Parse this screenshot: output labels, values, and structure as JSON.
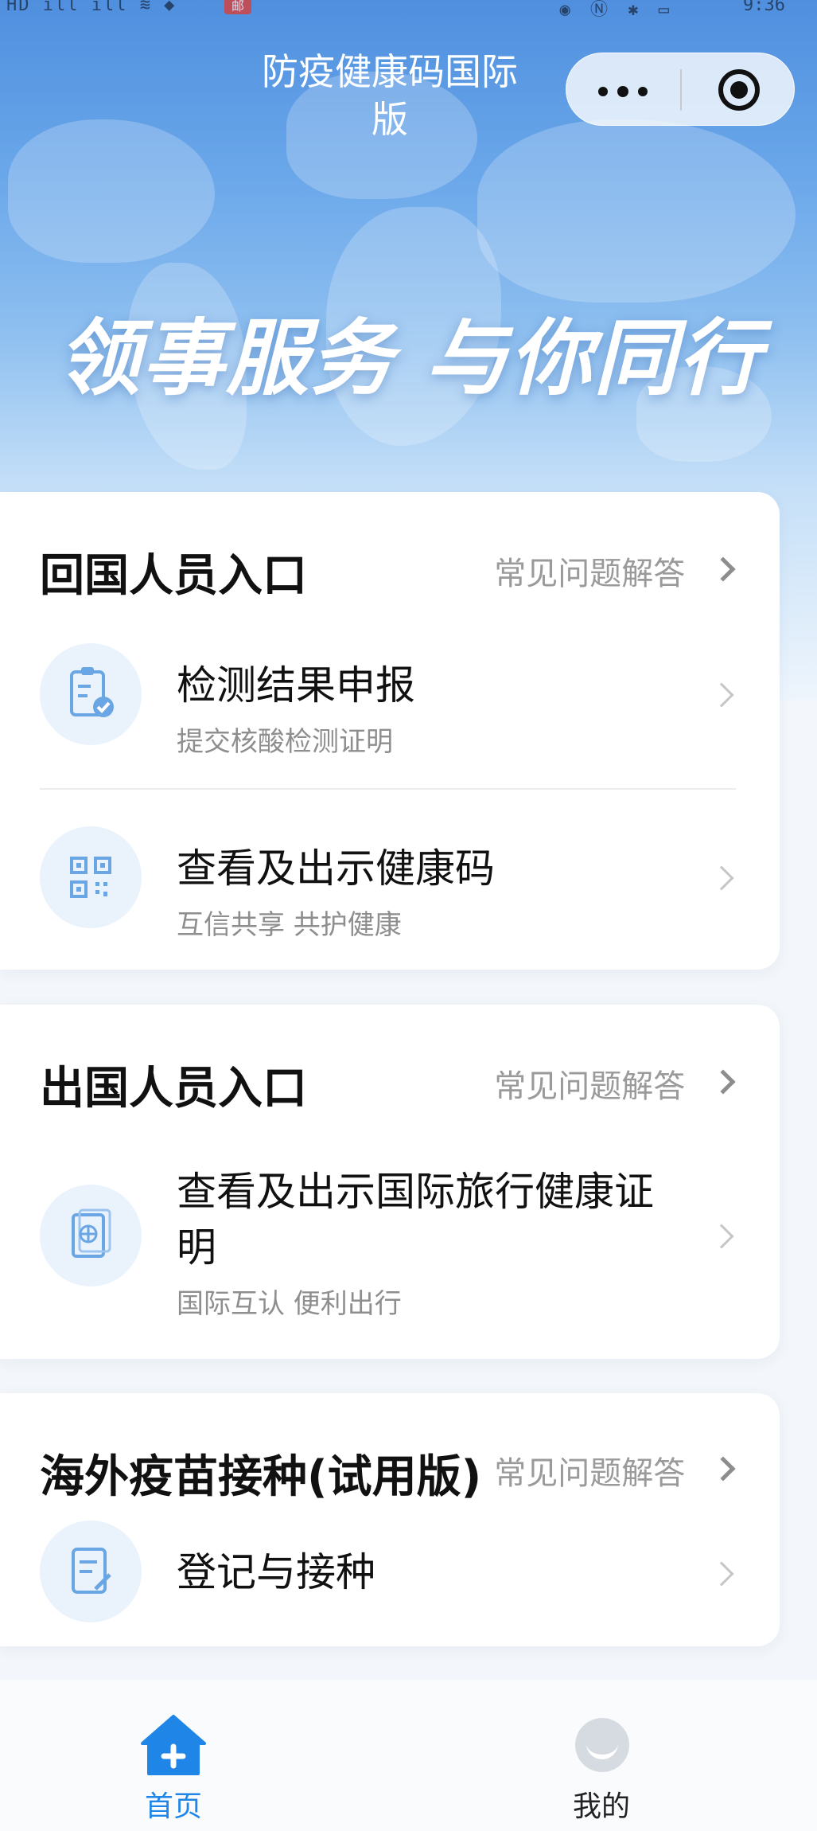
{
  "status_bar": {
    "left": "HD ıll ıll ≋ ◆",
    "badge": "邮",
    "right_icons": "◉ Ⓝ ✱ ▭",
    "time": "9:36"
  },
  "header": {
    "title": "防疫健康码国际版",
    "slogan": "领事服务 与你同行"
  },
  "sections": [
    {
      "title": "回国人员入口",
      "faq_label": "常见问题解答",
      "items": [
        {
          "title": "检测结果申报",
          "subtitle": "提交核酸检测证明",
          "icon": "clipboard-check-icon"
        },
        {
          "title": "查看及出示健康码",
          "subtitle": "互信共享 共护健康",
          "icon": "qr-code-icon"
        }
      ]
    },
    {
      "title": "出国人员入口",
      "faq_label": "常见问题解答",
      "items": [
        {
          "title_line1": "查看及出示国际旅行健康证",
          "title_line2": "明",
          "subtitle": "国际互认 便利出行",
          "icon": "passport-icon"
        }
      ]
    },
    {
      "title": "海外疫苗接种(试用版)",
      "faq_label": "常见问题解答",
      "items": [
        {
          "title": "登记与接种",
          "icon": "form-edit-icon"
        }
      ]
    }
  ],
  "tabbar": {
    "home_label": "首页",
    "me_label": "我的"
  },
  "colors": {
    "accent": "#1f86e8",
    "icon_bg": "#eaf3fc",
    "icon_stroke": "#6aa6e4"
  }
}
